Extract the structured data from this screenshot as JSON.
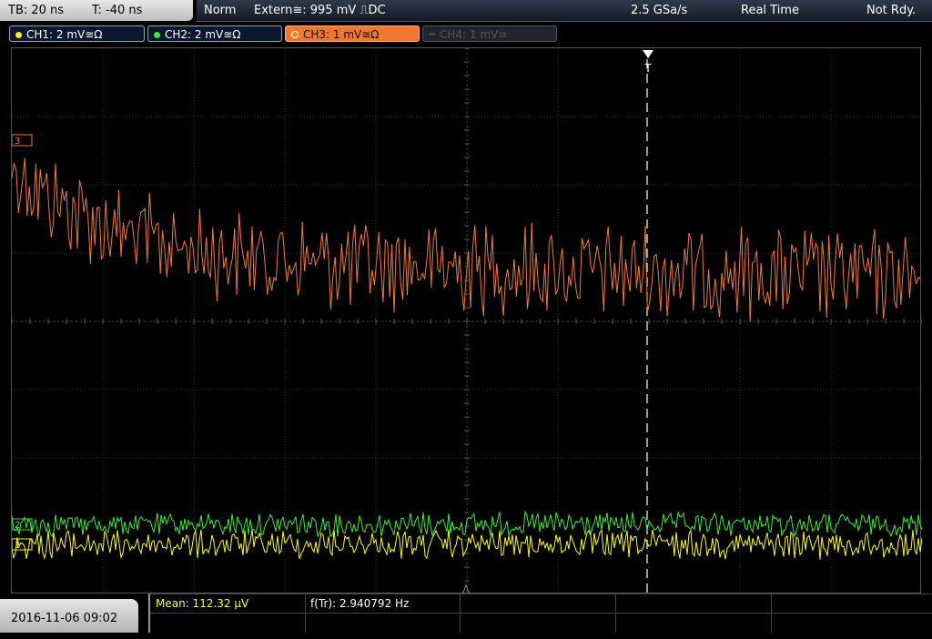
{
  "status": {
    "timebase": "TB: 20 ns",
    "trigger_time": "T: -40 ns",
    "mode": "Norm",
    "trigger_source": "Extern≅: 995 mV ⎍DC",
    "sample_rate": "2.5 GSa/s",
    "acq_mode": "Real Time",
    "ready_state": "Not Rdy."
  },
  "channels": [
    {
      "label": "CH1: 2 mV≅Ω",
      "color": "#ffff00"
    },
    {
      "label": "CH2: 2 mV≅Ω",
      "color": "#33ee33"
    },
    {
      "label": "CH3: 1 mV≅Ω",
      "color": "#f27a2a"
    },
    {
      "label": "CH4: 1 mV≅",
      "color": "#555555"
    }
  ],
  "trigger_marker": "T",
  "measurements": {
    "mean": "Mean: 112.32 µV",
    "frequency": "f(Tr): 2.940792 Hz"
  },
  "datetime": "2016-11-06 09:02",
  "channel_markers": [
    "1",
    "2",
    "3"
  ]
}
